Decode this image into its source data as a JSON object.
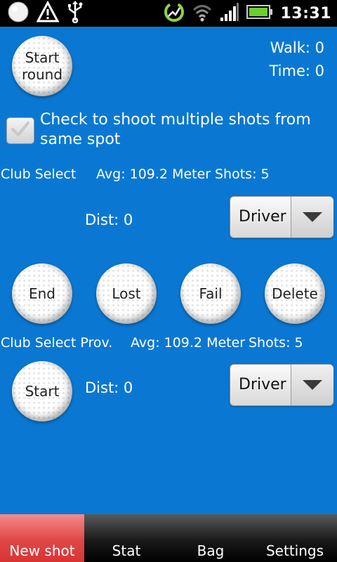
{
  "status_bar": {
    "time": "13:31",
    "icons_left": [
      "golf-ball-icon",
      "warning-icon",
      "usb-icon"
    ],
    "icons_right": [
      "sync-icon",
      "wifi-icon",
      "signal-icon",
      "battery-icon"
    ]
  },
  "header": {
    "start_round_label": "Start round",
    "walk_label": "Walk: 0",
    "time_label": "Time: 0"
  },
  "multi_shot": {
    "checked": true,
    "label": "Check to shoot multiple shots from same spot"
  },
  "club_select": {
    "label": "Club Select",
    "avg": "Avg: 109.2 Meter",
    "shots": "Shots: 5",
    "dist": "Dist: 0",
    "selected_club": "Driver"
  },
  "actions": {
    "end": "End",
    "lost": "Lost",
    "fail": "Fail",
    "delete": "Delete"
  },
  "club_select_prov": {
    "label": "Club Select Prov.",
    "avg": "Avg: 109.2 Meter",
    "shots": "Shots: 5",
    "start": "Start",
    "dist": "Dist: 0",
    "selected_club": "Driver"
  },
  "tabs": [
    {
      "label": "New shot",
      "active": true
    },
    {
      "label": "Stat",
      "active": false
    },
    {
      "label": "Bag",
      "active": false
    },
    {
      "label": "Settings",
      "active": false
    }
  ],
  "colors": {
    "background": "#0a78d2",
    "active_tab": "#e04747",
    "tab_bar": "#1a1a1a"
  }
}
